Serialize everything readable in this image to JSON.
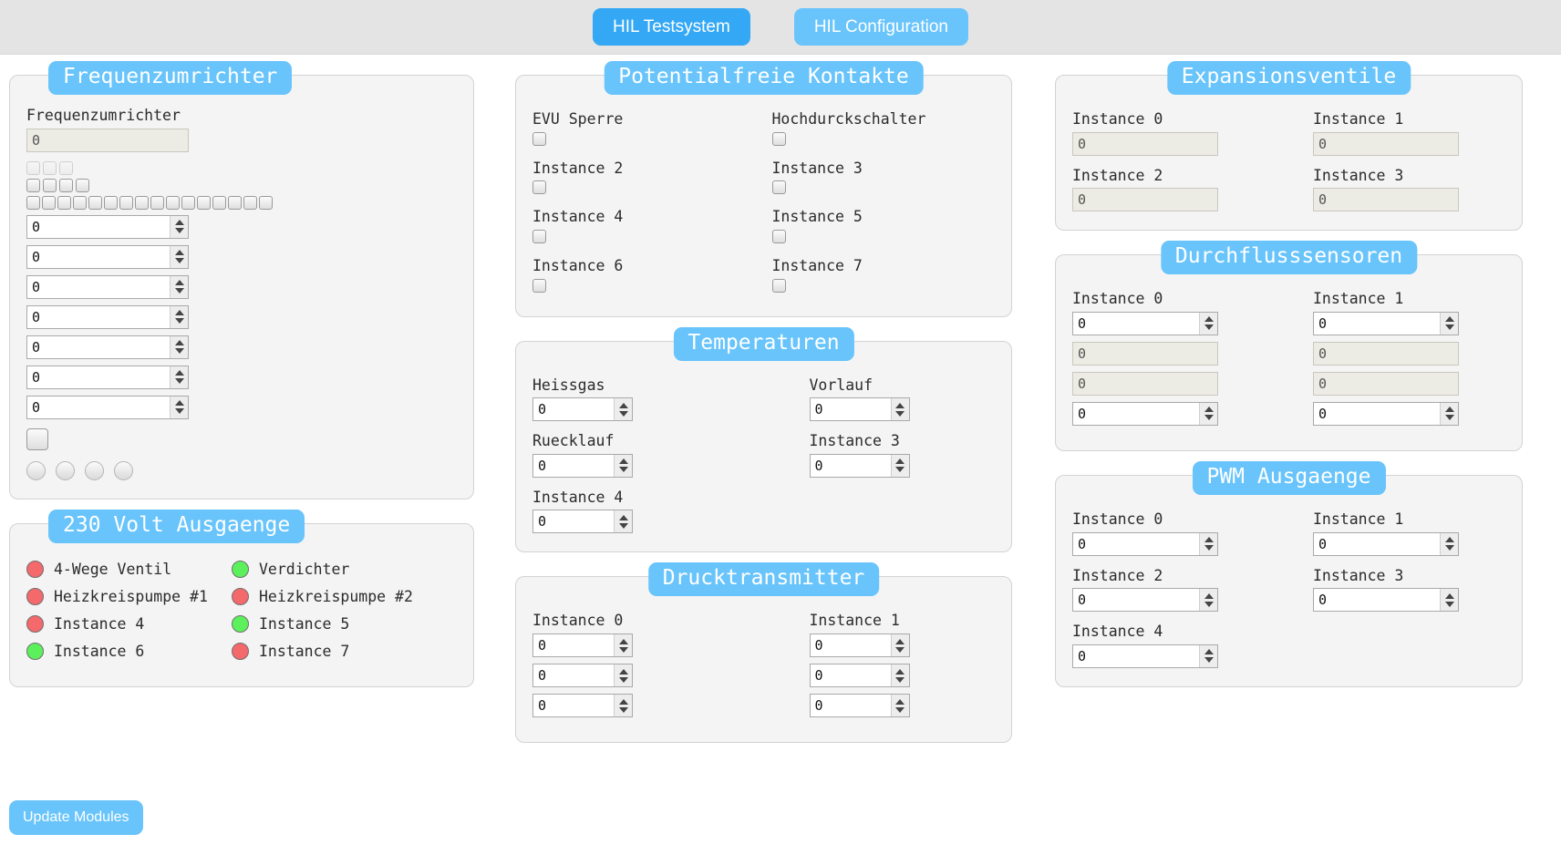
{
  "topbar": {
    "tabs": [
      {
        "label": "HIL Testsystem",
        "active": true
      },
      {
        "label": "HIL Configuration",
        "active": false
      }
    ]
  },
  "colors": {
    "accent": "#68c4fb",
    "accent_active": "#34a8f4",
    "led_red": "#f4696b",
    "led_green": "#5cf05c",
    "panel_bg": "#f4f4f4",
    "readonly_bg": "#ecebe4",
    "page_bg": "#ffffff",
    "topbar_bg": "#e4e4e4"
  },
  "panels": {
    "frequenzumrichter": {
      "legend": "Frequenzumrichter",
      "field_label": "Frequenzumrichter",
      "readonly_value": "0",
      "checkbox_row_1_count": 3,
      "checkbox_row_2_count": 4,
      "checkbox_row_3_count": 16,
      "spinners": [
        "0",
        "0",
        "0",
        "0",
        "0",
        "0",
        "0"
      ],
      "single_checkbox_checked": false,
      "led_count": 4
    },
    "volt230": {
      "legend": "230 Volt Ausgaenge",
      "outputs": [
        {
          "label": "4-Wege Ventil",
          "state": "red"
        },
        {
          "label": "Verdichter",
          "state": "green"
        },
        {
          "label": "Heizkreispumpe #1",
          "state": "red"
        },
        {
          "label": "Heizkreispumpe #2",
          "state": "red"
        },
        {
          "label": "Instance 4",
          "state": "red"
        },
        {
          "label": "Instance 5",
          "state": "green"
        },
        {
          "label": "Instance 6",
          "state": "green"
        },
        {
          "label": "Instance 7",
          "state": "red"
        }
      ]
    },
    "potentialfreie_kontakte": {
      "legend": "Potentialfreie Kontakte",
      "items": [
        {
          "label": "EVU Sperre",
          "checked": false
        },
        {
          "label": "Hochdurckschalter",
          "checked": false
        },
        {
          "label": "Instance 2",
          "checked": false
        },
        {
          "label": "Instance 3",
          "checked": false
        },
        {
          "label": "Instance 4",
          "checked": false
        },
        {
          "label": "Instance 5",
          "checked": false
        },
        {
          "label": "Instance 6",
          "checked": false
        },
        {
          "label": "Instance 7",
          "checked": false
        }
      ]
    },
    "temperaturen": {
      "legend": "Temperaturen",
      "items": [
        {
          "label": "Heissgas",
          "value": "0"
        },
        {
          "label": "Vorlauf",
          "value": "0"
        },
        {
          "label": "Ruecklauf",
          "value": "0"
        },
        {
          "label": "Instance 3",
          "value": "0"
        },
        {
          "label": "Instance 4",
          "value": "0"
        }
      ]
    },
    "drucktransmitter": {
      "legend": "Drucktransmitter",
      "columns": [
        {
          "label": "Instance 0",
          "values": [
            "0",
            "0",
            "0"
          ]
        },
        {
          "label": "Instance 1",
          "values": [
            "0",
            "0",
            "0"
          ]
        }
      ]
    },
    "expansionsventile": {
      "legend": "Expansionsventile",
      "items": [
        {
          "label": "Instance 0",
          "value": "0"
        },
        {
          "label": "Instance 1",
          "value": "0"
        },
        {
          "label": "Instance 2",
          "value": "0"
        },
        {
          "label": "Instance 3",
          "value": "0"
        }
      ]
    },
    "durchflusssensoren": {
      "legend": "Durchflusssensoren",
      "columns": [
        {
          "label": "Instance 0",
          "spin_top": "0",
          "ro_1": "0",
          "ro_2": "0",
          "spin_bottom": "0"
        },
        {
          "label": "Instance 1",
          "spin_top": "0",
          "ro_1": "0",
          "ro_2": "0",
          "spin_bottom": "0"
        }
      ]
    },
    "pwm_ausgaenge": {
      "legend": "PWM Ausgaenge",
      "items": [
        {
          "label": "Instance 0",
          "value": "0"
        },
        {
          "label": "Instance 1",
          "value": "0"
        },
        {
          "label": "Instance 2",
          "value": "0"
        },
        {
          "label": "Instance 3",
          "value": "0"
        },
        {
          "label": "Instance 4",
          "value": "0"
        }
      ]
    }
  },
  "footer": {
    "update_button": "Update Modules"
  }
}
